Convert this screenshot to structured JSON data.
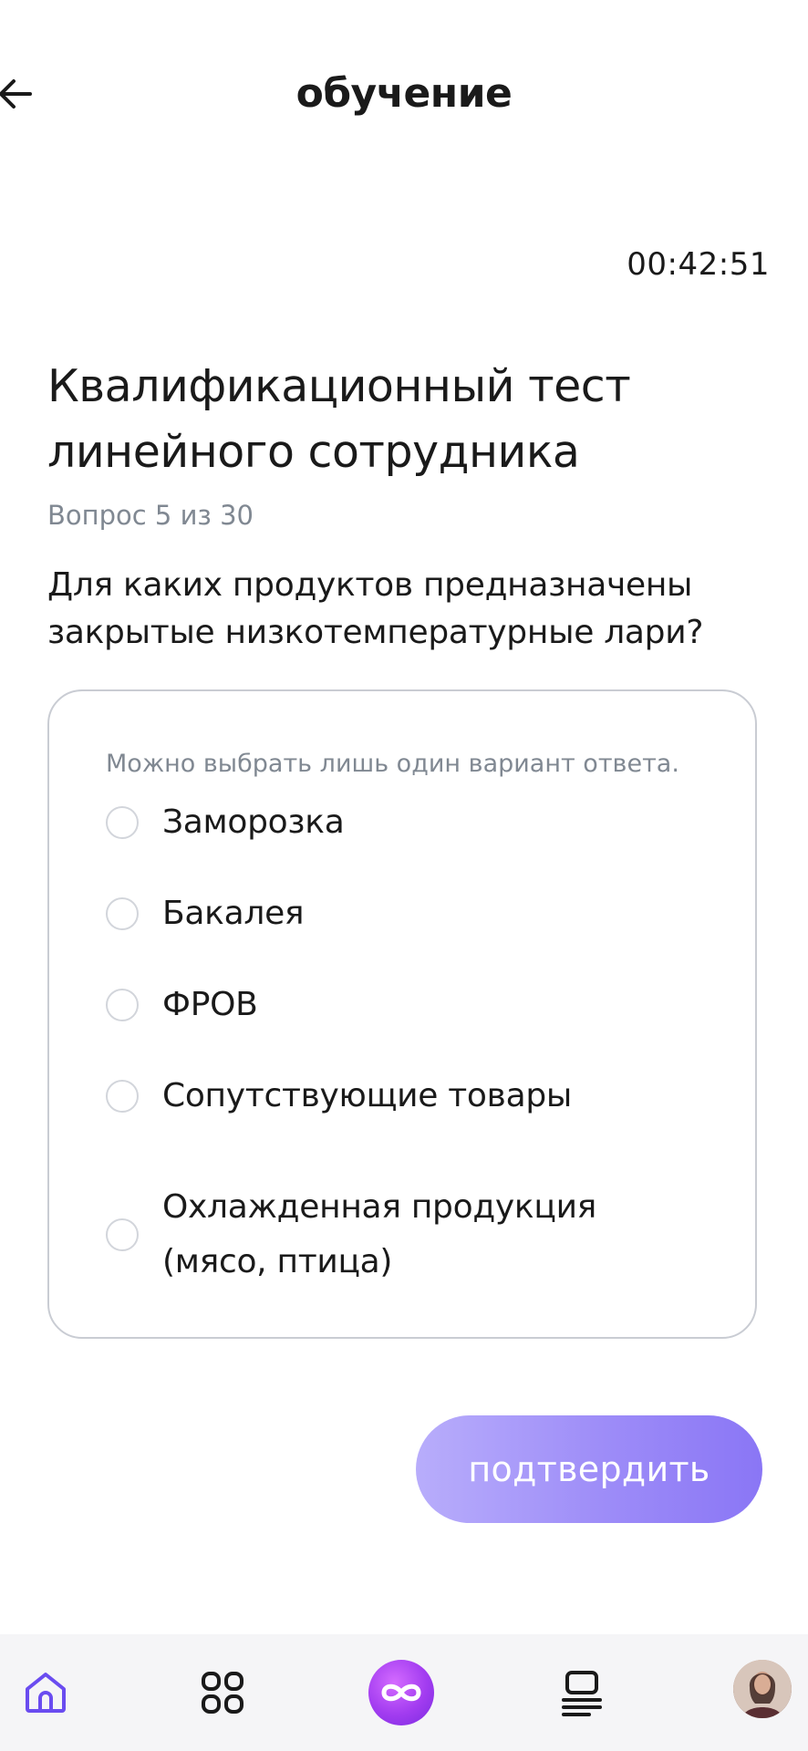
{
  "header": {
    "title": "обучение"
  },
  "timer": "00:42:51",
  "test": {
    "title": "Квалификационный тест линейного сотрудника",
    "counter": "Вопрос 5 из 30",
    "question": "Для каких продуктов предназначены закрытые низкотемпературные лари?",
    "hint": "Можно выбрать лишь один вариант ответа.",
    "options": [
      "Заморозка",
      "Бакалея",
      "ФРОВ",
      "Сопутствующие товары",
      "Охлажденная продукция (мясо, птица)"
    ]
  },
  "confirm_label": "подтвердить",
  "tabbar": {
    "items": [
      {
        "icon": "home-icon"
      },
      {
        "icon": "grid-icon"
      },
      {
        "icon": "infinity-icon"
      },
      {
        "icon": "courses-icon"
      },
      {
        "icon": "avatar"
      }
    ]
  },
  "colors": {
    "accent": "#9d8cf8",
    "ai_purple": "#a23cf0",
    "home_active": "#6a4cf0",
    "muted_text": "#808892",
    "card_border": "#c9ccd3"
  }
}
